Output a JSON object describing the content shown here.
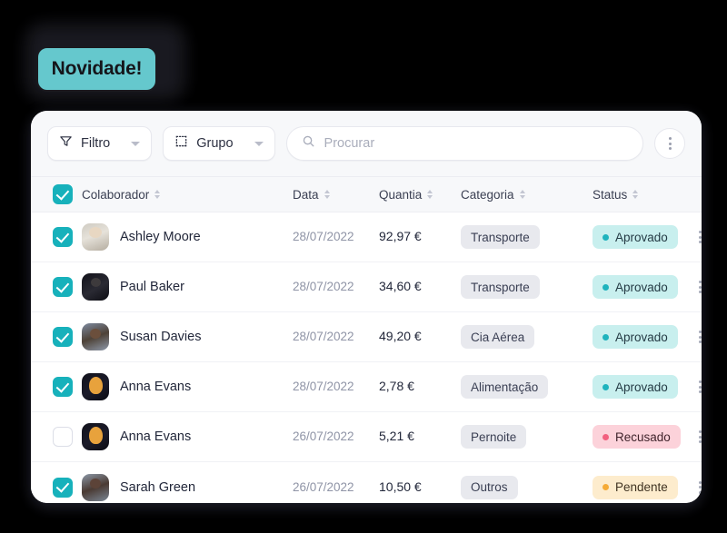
{
  "badge": {
    "label": "Novidade!",
    "color": "#65c8cd"
  },
  "toolbar": {
    "filter_label": "Filtro",
    "group_label": "Grupo",
    "search_placeholder": "Procurar",
    "search_value": "",
    "more_icon": "kebab-menu-icon"
  },
  "table": {
    "columns": [
      {
        "key": "colaborador",
        "label": "Colaborador",
        "sortable": true
      },
      {
        "key": "data",
        "label": "Data",
        "sortable": true
      },
      {
        "key": "quantia",
        "label": "Quantia",
        "sortable": true
      },
      {
        "key": "categoria",
        "label": "Categoria",
        "sortable": true
      },
      {
        "key": "status",
        "label": "Status",
        "sortable": true
      }
    ],
    "select_all_checked": true,
    "rows": [
      {
        "checked": true,
        "name": "Ashley Moore",
        "date": "28/07/2022",
        "amount": "92,97 €",
        "category": "Transporte",
        "status": "Aprovado",
        "status_kind": "aprovado"
      },
      {
        "checked": true,
        "name": "Paul Baker",
        "date": "28/07/2022",
        "amount": "34,60 €",
        "category": "Transporte",
        "status": "Aprovado",
        "status_kind": "aprovado"
      },
      {
        "checked": true,
        "name": "Susan Davies",
        "date": "28/07/2022",
        "amount": "49,20 €",
        "category": "Cia Aérea",
        "status": "Aprovado",
        "status_kind": "aprovado"
      },
      {
        "checked": true,
        "name": "Anna Evans",
        "date": "28/07/2022",
        "amount": "2,78 €",
        "category": "Alimentação",
        "status": "Aprovado",
        "status_kind": "aprovado"
      },
      {
        "checked": false,
        "name": "Anna Evans",
        "date": "26/07/2022",
        "amount": "5,21 €",
        "category": "Pernoite",
        "status": "Recusado",
        "status_kind": "recusado"
      },
      {
        "checked": true,
        "name": "Sarah Green",
        "date": "26/07/2022",
        "amount": "10,50 €",
        "category": "Outros",
        "status": "Pendente",
        "status_kind": "pendente"
      }
    ]
  },
  "status_colors": {
    "aprovado_bg": "#c8efee",
    "aprovado_dot": "#1fb3bd",
    "recusado_bg": "#fcd2da",
    "recusado_dot": "#f2607f",
    "pendente_bg": "#fdeccd",
    "pendente_dot": "#f5ab37",
    "checkbox_accent": "#17b1bb"
  }
}
